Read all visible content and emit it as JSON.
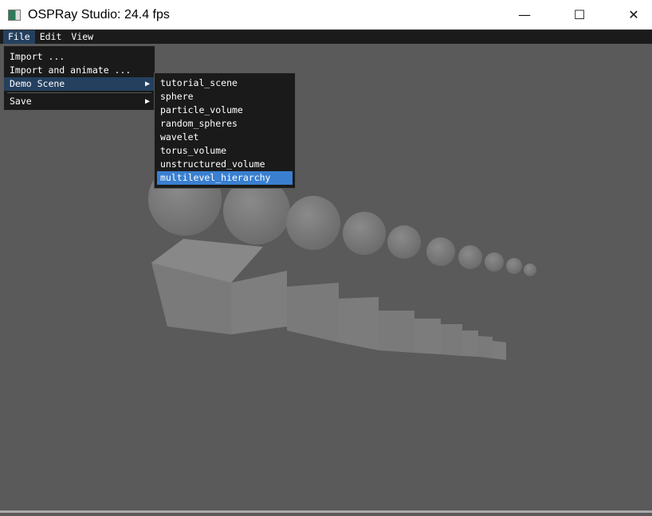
{
  "window": {
    "title": "OSPRay Studio: 24.4 fps",
    "minimize_icon": "minimize-icon",
    "maximize_icon": "maximize-icon",
    "close_icon": "close-icon"
  },
  "menubar": {
    "items": [
      "File",
      "Edit",
      "View"
    ],
    "active": "File"
  },
  "file_menu": {
    "items": [
      "Import ...",
      "Import and animate ...",
      "Demo Scene",
      "Save"
    ],
    "selected": "Demo Scene"
  },
  "demo_scene_menu": {
    "items": [
      "tutorial_scene",
      "sphere",
      "particle_volume",
      "random_spheres",
      "wavelet",
      "torus_volume",
      "unstructured_volume",
      "multilevel_hierarchy"
    ],
    "highlighted": "multilevel_hierarchy"
  },
  "colors": {
    "background": "#5a5a5a",
    "menu_bg": "#1a1a1a",
    "selected": "#25405f",
    "highlight": "#3a7fd0"
  }
}
